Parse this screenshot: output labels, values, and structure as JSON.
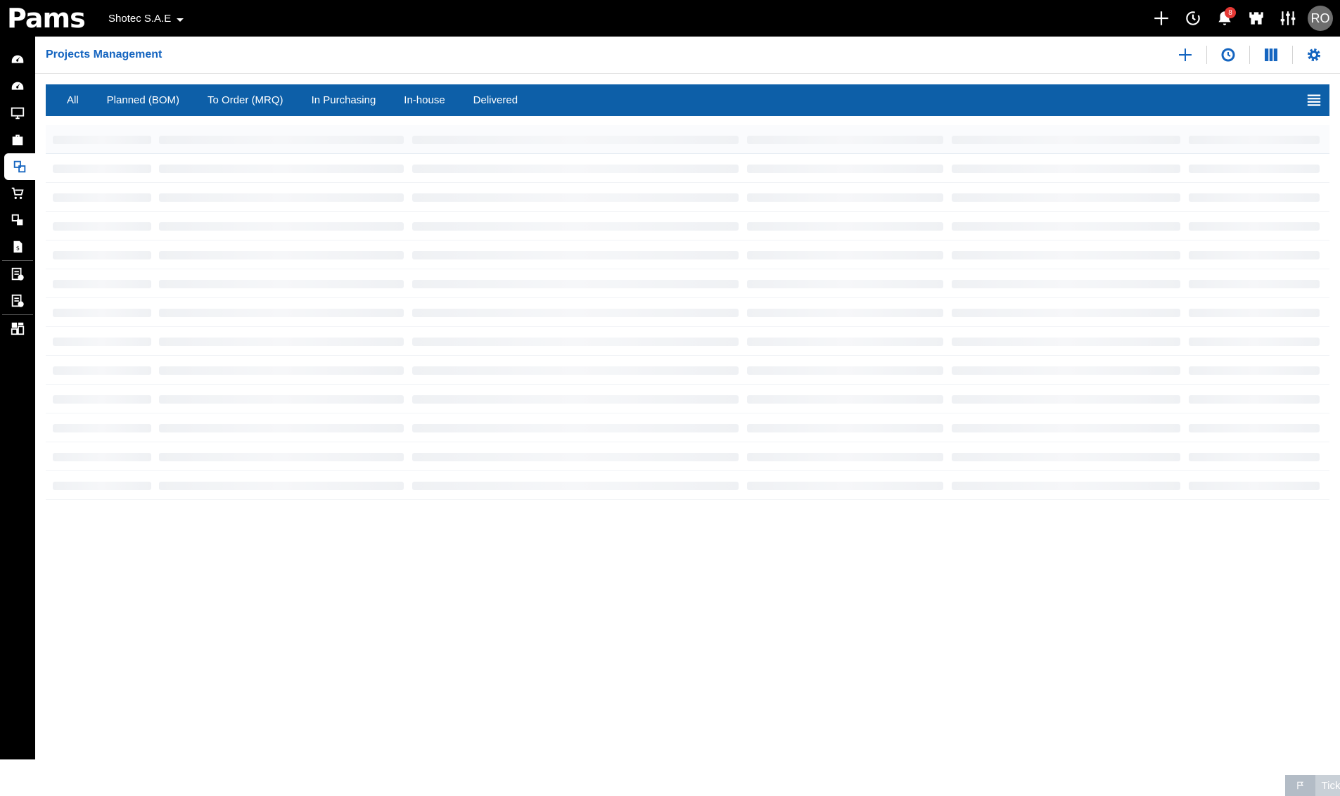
{
  "app": {
    "logo_text": "Pams",
    "company": "Shotec S.A.E",
    "notification_count": "8",
    "user_initials": "RO"
  },
  "page": {
    "title": "Projects Management"
  },
  "tabs": [
    {
      "label": "All"
    },
    {
      "label": "Planned (BOM)"
    },
    {
      "label": "To Order (MRQ)"
    },
    {
      "label": "In Purchasing"
    },
    {
      "label": "In-house"
    },
    {
      "label": "Delivered"
    }
  ],
  "footer": {
    "tickets_label": "Tickets"
  },
  "colors": {
    "brand": "#0d5fa8",
    "accent": "#1565c0",
    "topbar": "#000000"
  }
}
